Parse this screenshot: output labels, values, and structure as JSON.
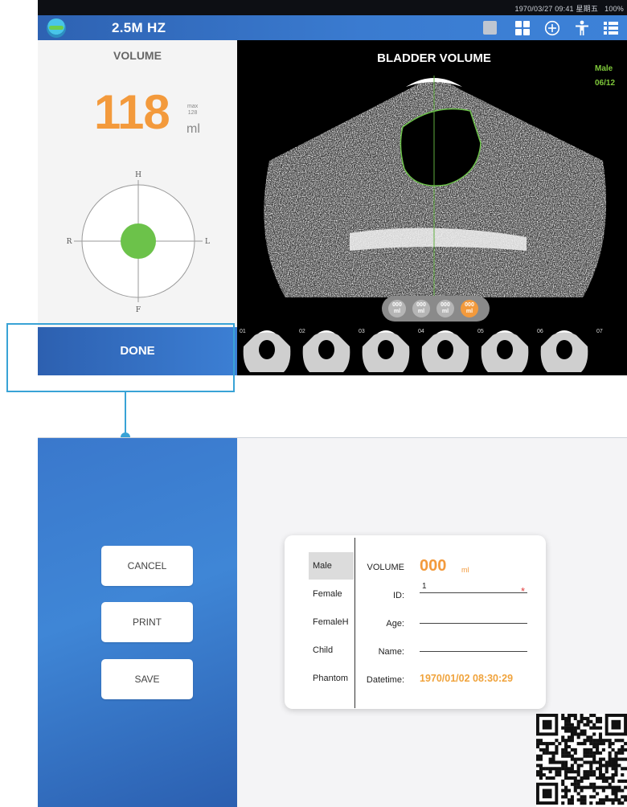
{
  "status_bar": {
    "datetime": "1970/03/27 09:41 星期五",
    "battery": "100%"
  },
  "app_bar": {
    "frequency": "2.5M HZ",
    "icons": [
      "square-icon",
      "grid-icon",
      "plus-circle-icon",
      "person-icon",
      "list-icon"
    ]
  },
  "volume_panel": {
    "title": "VOLUME",
    "value": "118",
    "max_label": "max",
    "max_value": "128",
    "unit": "ml",
    "compass": {
      "top": "H",
      "bottom": "F",
      "left": "R",
      "right": "L"
    },
    "done_label": "DONE"
  },
  "viewer": {
    "title": "BLADDER VOLUME",
    "patient_gender": "Male",
    "patient_date": "06/12",
    "pills": [
      {
        "value": "000",
        "unit": "ml",
        "active": false
      },
      {
        "value": "000",
        "unit": "ml",
        "active": false
      },
      {
        "value": "000",
        "unit": "ml",
        "active": false
      },
      {
        "value": "000",
        "unit": "ml",
        "active": true
      }
    ],
    "thumbnails": [
      "01",
      "02",
      "03",
      "04",
      "05",
      "06",
      "07"
    ]
  },
  "save_screen": {
    "buttons": {
      "cancel": "CANCEL",
      "print": "PRINT",
      "save": "SAVE"
    },
    "genders": [
      "Male",
      "Female",
      "FemaleH",
      "Child",
      "Phantom"
    ],
    "selected_gender": "Male",
    "form": {
      "volume_label": "VOLUME",
      "volume_value": "000",
      "volume_unit": "ml",
      "id_label": "ID:",
      "id_value": "1",
      "required_mark": "*",
      "age_label": "Age:",
      "name_label": "Name:",
      "datetime_label": "Datetime:",
      "datetime_value": "1970/01/02 08:30:29"
    }
  },
  "colors": {
    "accent_orange": "#f39a3c",
    "primary_blue": "#3a7bd0",
    "callout_blue": "#39a3d6",
    "green": "#6cc24a",
    "required_red": "#e23a3a"
  }
}
